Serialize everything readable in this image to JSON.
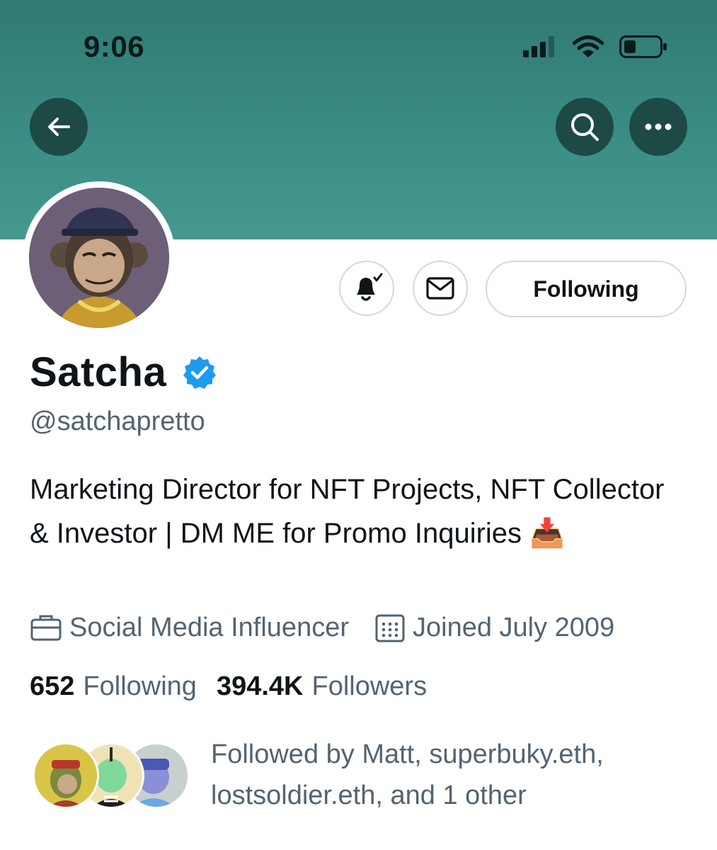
{
  "status_bar": {
    "time": "9:06"
  },
  "profile": {
    "display_name": "Satcha",
    "handle": "@satchapretto",
    "bio": "Marketing Director for NFT Projects, NFT Collector & Investor | DM ME for Promo Inquiries 📥",
    "category": "Social Media Influencer",
    "joined": "Joined July 2009",
    "following_count": "652",
    "following_label": "Following",
    "followers_count": "394.4K",
    "followers_label": "Followers",
    "followed_by": "Followed by Matt, superbuky.eth, lostsoldier.eth, and 1 other"
  },
  "actions": {
    "following_button": "Following"
  },
  "icons": {
    "back": "arrow-left-icon",
    "search": "search-icon",
    "more": "more-dots-icon",
    "notify": "bell-check-icon",
    "message": "envelope-icon",
    "verified": "verified-badge-icon",
    "category": "briefcase-icon",
    "joined": "calendar-icon"
  },
  "colors": {
    "banner": "#3a8c85",
    "header_button": "#1d4a45",
    "verified": "#1d9bf0",
    "secondary_text": "#536471"
  }
}
